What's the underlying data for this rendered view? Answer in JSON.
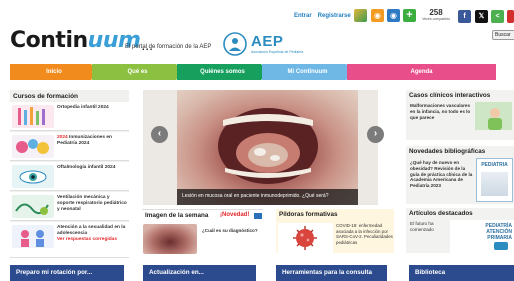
{
  "header": {
    "logo_prefix": "Contin",
    "logo_um": "uum",
    "logo_dots": "...",
    "tagline": "El portal de formación de la AEP",
    "aep_text": "AEP",
    "aep_sub": "Asociación Española de Pediatría",
    "links": {
      "enter": "Entrar",
      "register": "Registrarse"
    },
    "share_count": "258",
    "share_label": "Veces compartido",
    "search_label": "Buscar",
    "icons": [
      "book-icon",
      "rss-icon",
      "rss-blue-icon",
      "plus-icon"
    ],
    "social": [
      "facebook-icon",
      "x-icon",
      "share-icon",
      "external-icon"
    ]
  },
  "nav": {
    "items": [
      "Inicio",
      "Qué es",
      "Quiénes somos",
      "Mi Continuum",
      "Agenda"
    ],
    "colors": [
      "#f28b1d",
      "#8cc040",
      "#17a05d",
      "#6fb8e6",
      "#e84f8a"
    ]
  },
  "left": {
    "title": "Cursos de formación",
    "courses": [
      {
        "title": "Ortopedia infantil 2024",
        "badge": "",
        "extra": ""
      },
      {
        "title": "Inmunizaciones en Pediatría 2024",
        "badge": "2024",
        "extra": ""
      },
      {
        "title": "Oftalmología infantil 2024",
        "badge": "",
        "extra": ""
      },
      {
        "title": "Ventilación mecánica y soporte respiratorio pediátrico y neonatal",
        "badge": "",
        "extra": ""
      },
      {
        "title": "Atención a la sexualidad en la adolescencia",
        "badge": "",
        "extra": "Ver respuestas corregidas"
      }
    ]
  },
  "carousel": {
    "caption": "Lesión en mucosa oral en paciente inmunodeprimido. ¿Qué será?",
    "prev": "‹",
    "next": "›"
  },
  "image_week": {
    "title": "Imagen de la semana",
    "new_label": "¡Novedad!",
    "question": "¿Cuál es su diagnóstico?"
  },
  "pildoras": {
    "title": "Píldoras formativas",
    "text": "COVID-19: enfermedad asociada a la infección por SARS-CoV-2. Peculiaridades pediátricas"
  },
  "right": {
    "cases_title": "Casos clínicos interactivos",
    "cases_text": "Malformaciones vasculares en la infancia, no todo es lo que parece",
    "news_title": "Novedades bibliográficas",
    "news_text": "¿Qué hay de nuevo en obesidad? Revisión de la guía de práctica clínica de la Academia Americana de Pediatría 2023",
    "news_book": "PEDIATRIA",
    "featured_title": "Artículos destacados",
    "featured_text": "El futuro ha comenzado",
    "featured_book": "PEDIATRÍA ATENCIÓN PRIMARIA"
  },
  "bottom_tabs": [
    "Preparo mi rotación por...",
    "Actualización en...",
    "Herramientas para la consulta",
    "Biblioteca"
  ]
}
